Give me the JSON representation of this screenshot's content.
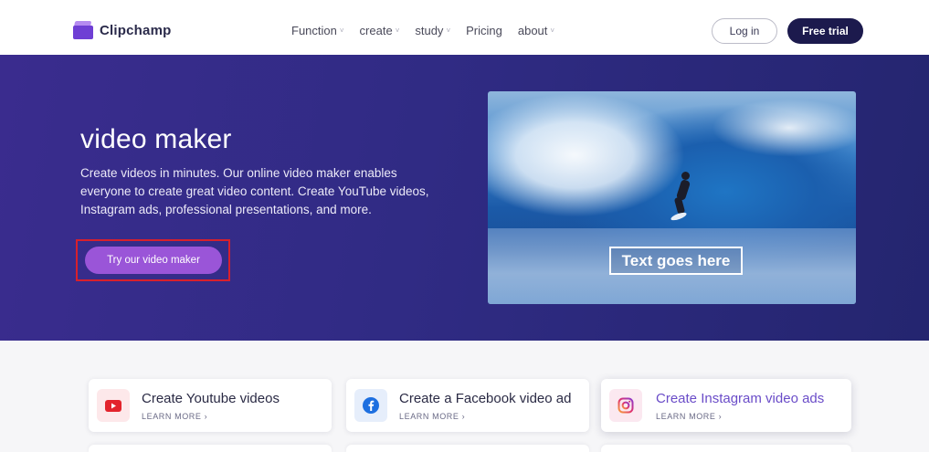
{
  "header": {
    "brand": "Clipchamp",
    "nav": [
      {
        "label": "Function",
        "chevron": "˅"
      },
      {
        "label": "create",
        "chevron": "˅"
      },
      {
        "label": "study",
        "chevron": "˅"
      },
      {
        "label": "Pricing",
        "chevron": ""
      },
      {
        "label": "about",
        "chevron": "˅"
      }
    ],
    "login_label": "Log in",
    "trial_label": "Free trial"
  },
  "hero": {
    "title": "video maker",
    "description": "Create videos in minutes. Our online video maker enables everyone to create great video content. Create YouTube videos, Instagram ads, professional presentations, and more.",
    "cta_label": "Try our video maker",
    "preview_overlay_text": "Text goes here"
  },
  "cards": [
    {
      "title": "Create Youtube videos",
      "link": "LEARN MORE ›",
      "icon": "youtube-icon"
    },
    {
      "title": "Create a Facebook video ad",
      "link": "LEARN MORE ›",
      "icon": "facebook-icon"
    },
    {
      "title": "Create Instagram video ads",
      "link": "LEARN MORE ›",
      "icon": "instagram-icon"
    }
  ],
  "colors": {
    "accent": "#9a55d8",
    "brand_dark": "#1c1a4d",
    "hero_bg": "#302b84",
    "highlight_border": "#d8202c"
  }
}
